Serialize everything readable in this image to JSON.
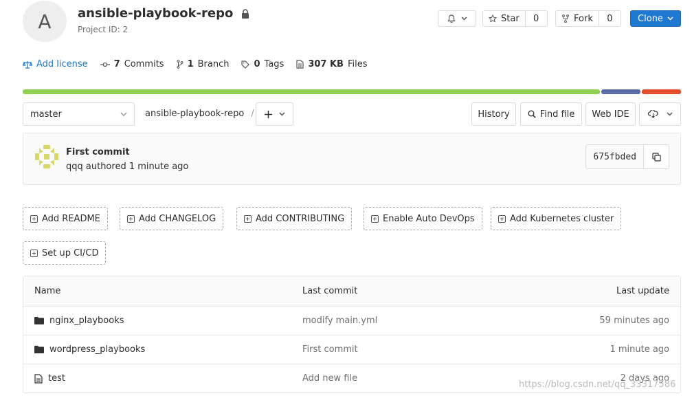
{
  "project": {
    "avatar_letter": "A",
    "title": "ansible-playbook-repo",
    "project_id": "Project ID: 2"
  },
  "actions": {
    "star_label": "Star",
    "star_count": "0",
    "fork_label": "Fork",
    "fork_count": "0",
    "clone_label": "Clone"
  },
  "stats": {
    "add_license": "Add license",
    "commits_count": "7",
    "commits_label": "Commits",
    "branch_count": "1",
    "branch_label": "Branch",
    "tags_count": "0",
    "tags_label": "Tags",
    "files_size": "307 KB",
    "files_label": "Files"
  },
  "languages": [
    {
      "color": "#8fd14f",
      "fraction": 0.88
    },
    {
      "color": "#5b6ba8",
      "fraction": 0.06
    },
    {
      "color": "#e24d2a",
      "fraction": 0.06
    }
  ],
  "repo_nav": {
    "branch": "master",
    "breadcrumb_root": "ansible-playbook-repo",
    "separator": "/",
    "history": "History",
    "find_file": "Find file",
    "web_ide": "Web IDE"
  },
  "last_commit": {
    "title": "First commit",
    "meta": "qqq authored 1 minute ago",
    "sha": "675fbded"
  },
  "quick_actions": [
    "Add README",
    "Add CHANGELOG",
    "Add CONTRIBUTING",
    "Enable Auto DevOps",
    "Add Kubernetes cluster",
    "Set up CI/CD"
  ],
  "tree": {
    "headers": {
      "name": "Name",
      "commit": "Last commit",
      "update": "Last update"
    },
    "rows": [
      {
        "name": "nginx_playbooks",
        "type": "folder",
        "commit": "modify main.yml",
        "update": "59 minutes ago"
      },
      {
        "name": "wordpress_playbooks",
        "type": "folder",
        "commit": "First commit",
        "update": "1 minute ago"
      },
      {
        "name": "test",
        "type": "file",
        "commit": "Add new file",
        "update": "2 days ago"
      }
    ]
  },
  "watermark": "https://blog.csdn.net/qq_33317586"
}
